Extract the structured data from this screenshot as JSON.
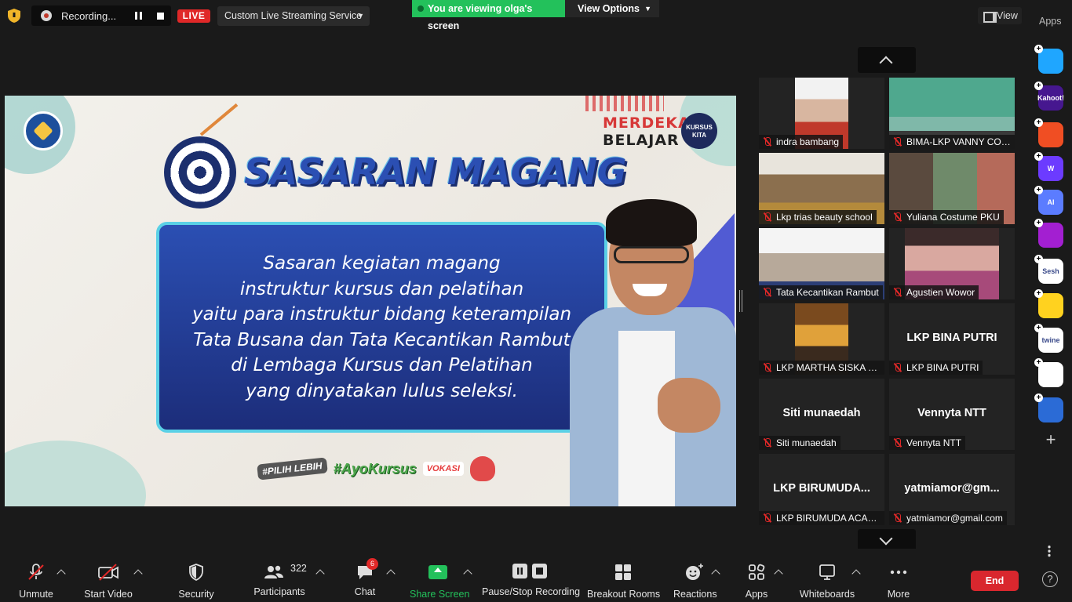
{
  "topbar": {
    "recording_label": "Recording...",
    "live_label": "LIVE",
    "stream_service": "Custom Live Streaming Service",
    "viewing_banner": "You are viewing olga's screen",
    "view_options": "View Options",
    "view_label": "View",
    "apps_label": "Apps"
  },
  "slide": {
    "title": "SASARAN MAGANG",
    "brand_line1": "MERDEKA",
    "brand_line2": "BELAJAR",
    "badge": "KURSUS KITA",
    "body_lines": [
      "Sasaran kegiatan magang",
      "instruktur kursus dan pelatihan",
      "yaitu para instruktur bidang keterampilan",
      "Tata Busana dan Tata Kecantikan Rambut",
      "di Lembaga Kursus dan Pelatihan",
      "yang dinyatakan lulus seleksi."
    ],
    "hashtags": [
      "#PILIH LEBIH",
      "#AyoKursus",
      "VOKASI"
    ]
  },
  "gallery": [
    {
      "label": "indra bambang",
      "big": ""
    },
    {
      "label": "BIMA-LKP VANNY COLLECTION",
      "big": ""
    },
    {
      "label": "Lkp trias beauty school",
      "big": ""
    },
    {
      "label": "Yuliana Costume PKU",
      "big": ""
    },
    {
      "label": "Tata Kecantikan Rambut",
      "big": ""
    },
    {
      "label": "Agustien Wowor",
      "big": ""
    },
    {
      "label": "LKP MARTHA SISKA SALON",
      "big": ""
    },
    {
      "label": "LKP BINA PUTRI",
      "big": "LKP BINA PUTRI"
    },
    {
      "label": "Siti munaedah",
      "big": "Siti munaedah"
    },
    {
      "label": "Vennyta NTT",
      "big": "Vennyta NTT"
    },
    {
      "label": "LKP BIRUMUDA ACADEMY",
      "big": "LKP BIRUMUDA..."
    },
    {
      "label": "yatmiamor@gmail.com",
      "big": "yatmiamor@gm..."
    }
  ],
  "apps_rail": [
    {
      "name": "flash-app-icon",
      "text": "",
      "color": "#1fa6ff"
    },
    {
      "name": "kahoot-app-icon",
      "text": "Kahoot!",
      "color": "#46178f"
    },
    {
      "name": "red-app-icon",
      "text": "",
      "color": "#f04e23"
    },
    {
      "name": "wooclap-app-icon",
      "text": "W",
      "color": "#6c3bff"
    },
    {
      "name": "ai-app-icon",
      "text": "AI",
      "color": "#5b7cff"
    },
    {
      "name": "radial-app-icon",
      "text": "",
      "color": "#a31fd1"
    },
    {
      "name": "sesh-app-icon",
      "text": "Sesh",
      "color": "#ffffff"
    },
    {
      "name": "smile-app-icon",
      "text": "",
      "color": "#ffd21f"
    },
    {
      "name": "twine-app-icon",
      "text": "twine",
      "color": "#ffffff"
    },
    {
      "name": "blocks-app-icon",
      "text": "",
      "color": "#ffffff"
    },
    {
      "name": "sync-app-icon",
      "text": "",
      "color": "#2b6bd6"
    }
  ],
  "toolbar": {
    "unmute": "Unmute",
    "start_video": "Start Video",
    "security": "Security",
    "participants": "Participants",
    "participants_count": "322",
    "chat": "Chat",
    "chat_badge": "6",
    "share_screen": "Share Screen",
    "pause_stop": "Pause/Stop Recording",
    "breakout": "Breakout Rooms",
    "reactions": "Reactions",
    "apps": "Apps",
    "whiteboards": "Whiteboards",
    "more": "More",
    "end": "End",
    "help": "?"
  },
  "colors": {
    "accent_green": "#23c15b",
    "live_red": "#e02828",
    "end_red": "#d9272e",
    "slide_blue": "#2b4fb3"
  }
}
